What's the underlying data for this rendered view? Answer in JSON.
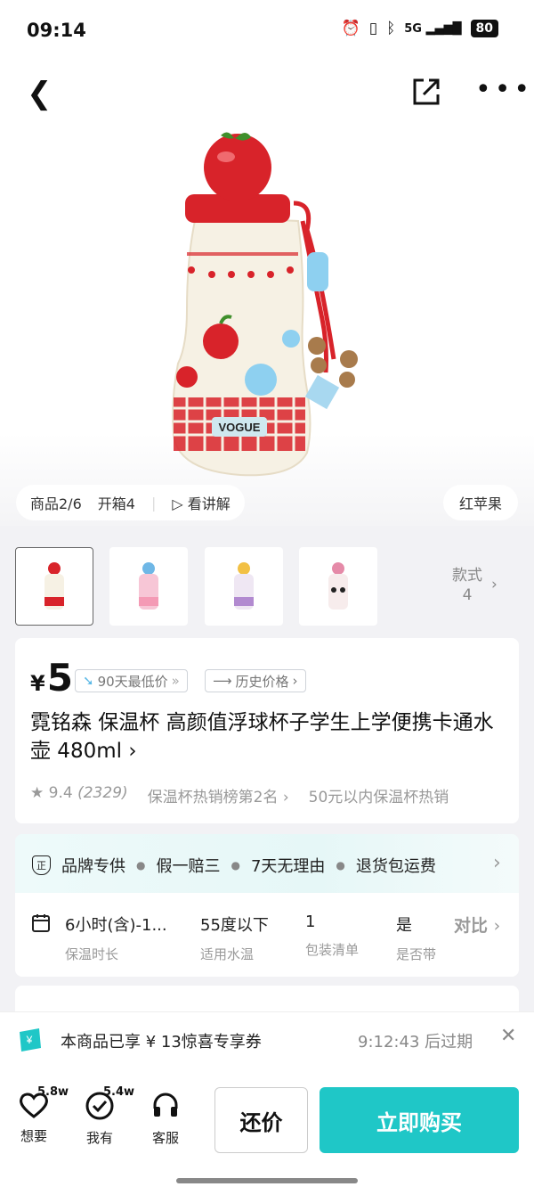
{
  "status_bar": {
    "time": "09:14",
    "battery": "80",
    "network": "5G"
  },
  "media": {
    "chips": [
      "商品2/6",
      "开箱4",
      "看讲解"
    ],
    "variant_chip": "红苹果",
    "thumbnails": [
      "thumb-red",
      "thumb-pink",
      "thumb-purple",
      "thumb-panda"
    ],
    "styles_label": "款式",
    "styles_count": "4",
    "bottle_brand": "VOGUE"
  },
  "price": {
    "currency": "¥",
    "amount": "5",
    "low_tag": "90天最低价",
    "history_tag": "历史价格"
  },
  "title": "霓铭森 保温杯 高颜值浮球杯子学生上学便携卡通水壶 480ml ›",
  "rating": {
    "score": "9.4",
    "count": "(2329)",
    "rank1": "保温杯热销榜第2名 ›",
    "rank2": "50元以内保温杯热销"
  },
  "service": [
    "品牌专供",
    "假一赔三",
    "7天无理由",
    "退货包运费"
  ],
  "specs": [
    {
      "value": "6小时(含)-1...",
      "label": "保温时长"
    },
    {
      "value": "55度以下",
      "label": "适用水温"
    },
    {
      "value": "1",
      "label": "包装清单"
    },
    {
      "value": "是",
      "label": "是否带"
    }
  ],
  "compare_label": "对比",
  "coupon": {
    "text": "本商品已享 ¥ 13惊喜专享券",
    "expiry": "9:12:43 后过期"
  },
  "bottom": {
    "want_label": "想要",
    "want_count": "5.8w",
    "have_label": "我有",
    "have_count": "5.4w",
    "service_label": "客服",
    "bargain": "还价",
    "buy": "立即购买"
  },
  "colors": {
    "accent": "#1fc7c7",
    "apple_red": "#d8232a"
  }
}
